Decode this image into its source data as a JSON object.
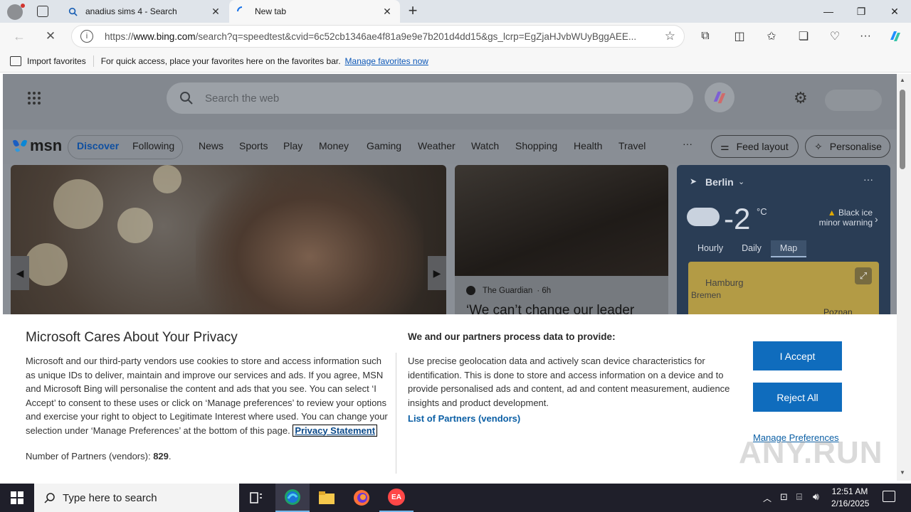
{
  "browser": {
    "tabs": [
      {
        "title": "anadius sims 4 - Search"
      },
      {
        "title": "New tab"
      }
    ],
    "url_prefix": "https://",
    "url_host": "www.bing.com",
    "url_rest": "/search?q=speedtest&cvid=6c52cb1346ae4f81a9e9e7b201d4dd15&gs_lcrp=EgZjaHJvbWUyBggAEE...",
    "favorites_bar": {
      "import_label": "Import favorites",
      "hint": "For quick access, place your favorites here on the favorites bar.",
      "manage_link": "Manage favorites now"
    }
  },
  "msn": {
    "search_placeholder": "Search the web",
    "logo_text": "msn",
    "nav_tabs": [
      "Discover",
      "Following"
    ],
    "nav_items": [
      "News",
      "Sports",
      "Play",
      "Money",
      "Gaming",
      "Weather",
      "Watch",
      "Shopping",
      "Health",
      "Travel"
    ],
    "more": "···",
    "feed_layout": "Feed layout",
    "personalise": "Personalise",
    "news_card": {
      "source": "The Guardian",
      "age": "· 6h",
      "headline": "‘We can’t change our leader"
    },
    "weather": {
      "city": "Berlin",
      "temperature": "-2",
      "unit": "°C",
      "warning": "Black ice minor warning",
      "tabs": [
        "Hourly",
        "Daily",
        "Map"
      ],
      "map_labels": [
        "Hamburg",
        "Bremen",
        "Poznan"
      ]
    }
  },
  "consent": {
    "title": "Microsoft Cares About Your Privacy",
    "body": "Microsoft and our third-party vendors use cookies to store and access information such as unique IDs to deliver, maintain and improve our services and ads. If you agree, MSN and Microsoft Bing will personalise the content and ads that you see. You can select ‘I Accept’ to consent to these uses or click on ‘Manage preferences’ to review your options and exercise your right to object to Legitimate Interest where used. You can change your selection under ‘Manage Preferences’ at the bottom of this page.",
    "privacy_link": "Privacy Statement",
    "partners_label": "Number of Partners (vendors):",
    "partners_count": "829",
    "right_title": "We and our partners process data to provide:",
    "right_body": "Use precise geolocation data and actively scan device characteristics for identification. This is done to store and access information on a device and to provide personalised ads and content, ad and content measurement, audience insights and product development.",
    "vendors_link": "List of Partners (vendors)",
    "accept": "I Accept",
    "reject": "Reject All",
    "manage": "Manage Preferences"
  },
  "watermark": "ANY.RUN",
  "taskbar": {
    "search_placeholder": "Type here to search",
    "time": "12:51 AM",
    "date": "2/16/2025"
  },
  "colors": {
    "accent": "#0f6cbd",
    "link": "#0b5fa5",
    "taskbar": "#1f1f2a"
  }
}
